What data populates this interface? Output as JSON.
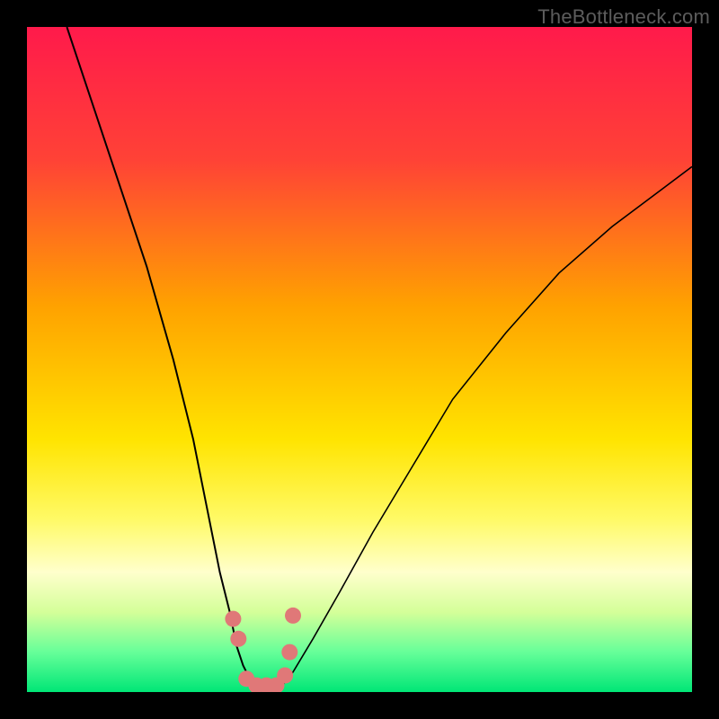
{
  "watermark": "TheBottleneck.com",
  "chart_data": {
    "type": "line",
    "title": "",
    "xlabel": "",
    "ylabel": "",
    "xlim": [
      0,
      100
    ],
    "ylim": [
      0,
      100
    ],
    "grid": false,
    "background_gradient": {
      "stops": [
        {
          "offset": 0.0,
          "color": "#ff1a4b"
        },
        {
          "offset": 0.2,
          "color": "#ff4236"
        },
        {
          "offset": 0.42,
          "color": "#ffa200"
        },
        {
          "offset": 0.62,
          "color": "#ffe400"
        },
        {
          "offset": 0.74,
          "color": "#fffa66"
        },
        {
          "offset": 0.82,
          "color": "#ffffcc"
        },
        {
          "offset": 0.88,
          "color": "#d4ff99"
        },
        {
          "offset": 0.94,
          "color": "#66ff99"
        },
        {
          "offset": 1.0,
          "color": "#00e676"
        }
      ]
    },
    "series": [
      {
        "name": "left-branch",
        "color": "#000000",
        "width": 2,
        "x": [
          6,
          10,
          14,
          18,
          22,
          25,
          27,
          29,
          30.5,
          31.5,
          32.5,
          33.5,
          34.5
        ],
        "y": [
          100,
          88,
          76,
          64,
          50,
          38,
          28,
          18,
          12,
          7,
          4,
          2,
          0.5
        ]
      },
      {
        "name": "right-branch",
        "color": "#000000",
        "width": 1.6,
        "x": [
          38,
          40,
          43,
          47,
          52,
          58,
          64,
          72,
          80,
          88,
          96,
          100
        ],
        "y": [
          0.5,
          3,
          8,
          15,
          24,
          34,
          44,
          54,
          63,
          70,
          76,
          79
        ]
      },
      {
        "name": "optimal-zone-marker",
        "color": "#e07878",
        "type": "scatter",
        "marker_radius_px": 9,
        "x": [
          31.0,
          31.8,
          33.0,
          34.5,
          36.0,
          37.5,
          38.8,
          39.5,
          40.0
        ],
        "y": [
          11.0,
          8.0,
          2.0,
          1.0,
          1.0,
          1.0,
          2.5,
          6.0,
          11.5
        ]
      }
    ]
  }
}
